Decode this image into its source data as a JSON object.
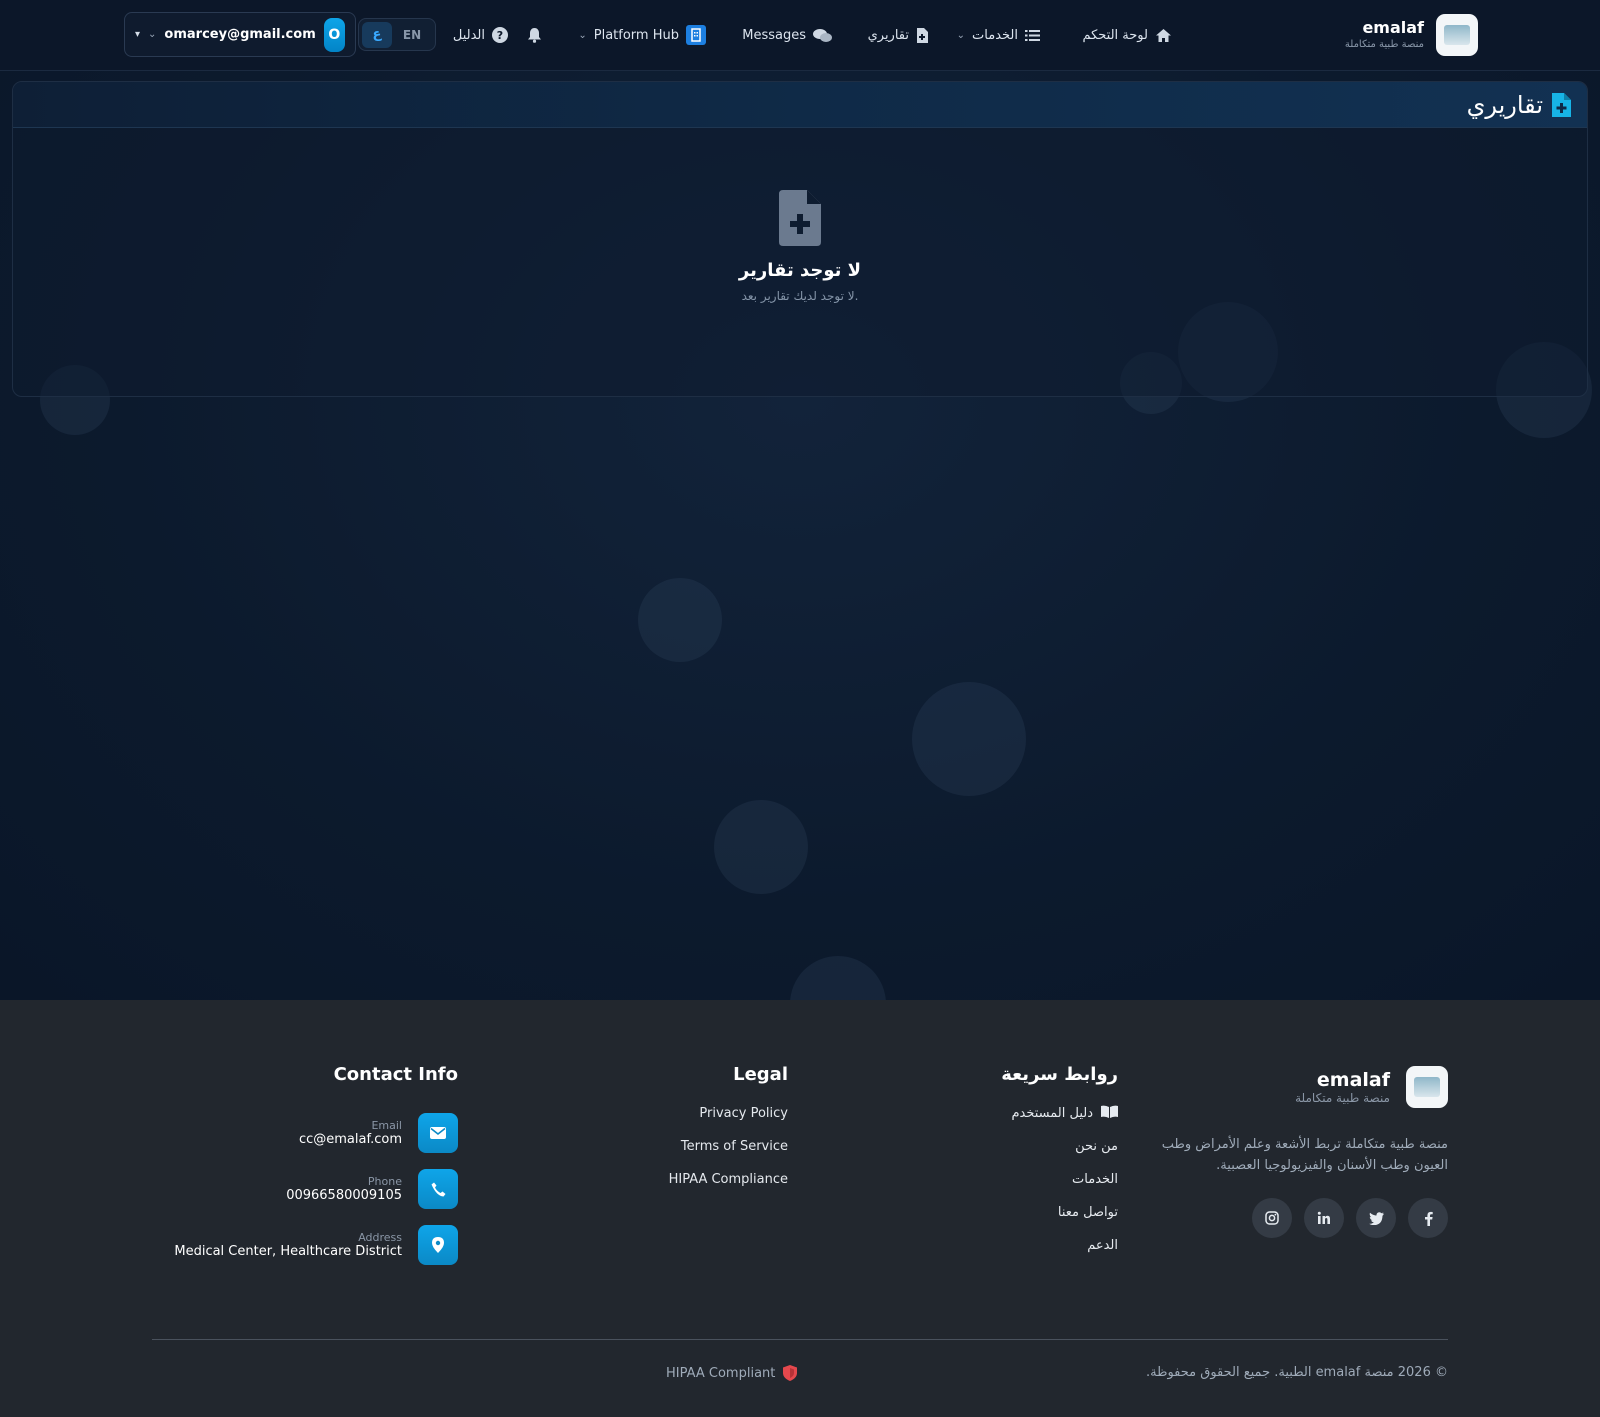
{
  "brand": {
    "name": "emalaf",
    "subtitle": "منصة طبية متكاملة"
  },
  "nav": {
    "dashboard": "لوحة التحكم",
    "services": "الخدمات",
    "reports": "تقاريري",
    "messages": "Messages",
    "platform_hub": "Platform Hub",
    "guide": "الدليل"
  },
  "language": {
    "active": "ع",
    "other": "EN"
  },
  "user": {
    "email": "omarcey@gmail.com",
    "avatar_letter": "O"
  },
  "reports": {
    "title": "تقاريري",
    "empty_title": "لا توجد تقارير",
    "empty_subtitle": "لا توجد لديك تقارير بعد."
  },
  "footer": {
    "brand_name": "emalaf",
    "brand_subtitle": "منصة طبية متكاملة",
    "description": "منصة طبية متكاملة تربط الأشعة وعلم الأمراض وطب العيون وطب الأسنان والفيزيولوجيا العصبية.",
    "quick_links_title": "روابط سريعة",
    "quick_links": [
      "دليل المستخدم",
      "من نحن",
      "الخدمات",
      "تواصل معنا",
      "الدعم"
    ],
    "legal_title": "Legal",
    "legal_links": [
      "Privacy Policy",
      "Terms of Service",
      "HIPAA Compliance"
    ],
    "contact_title": "Contact Info",
    "contact": {
      "email_label": "Email",
      "email": "cc@emalaf.com",
      "phone_label": "Phone",
      "phone": "00966580009105",
      "address_label": "Address",
      "address": "Medical Center, Healthcare District"
    },
    "copyright": "© 2026 منصة emalaf الطبية. جميع الحقوق محفوظة.",
    "hipaa_badge": "HIPAA Compliant"
  },
  "icons": {
    "home": "home-icon",
    "list": "list-icon",
    "report": "file-medical-icon",
    "messages": "comments-icon",
    "hub": "building-icon",
    "bell": "bell-icon",
    "help": "question-circle-icon",
    "book": "book-icon",
    "shield": "shield-icon"
  },
  "colors": {
    "accent": "#0ea5e9",
    "nav_bg": "#0c1729",
    "footer_bg": "#22272e",
    "hipaa_red": "#e5484d"
  }
}
